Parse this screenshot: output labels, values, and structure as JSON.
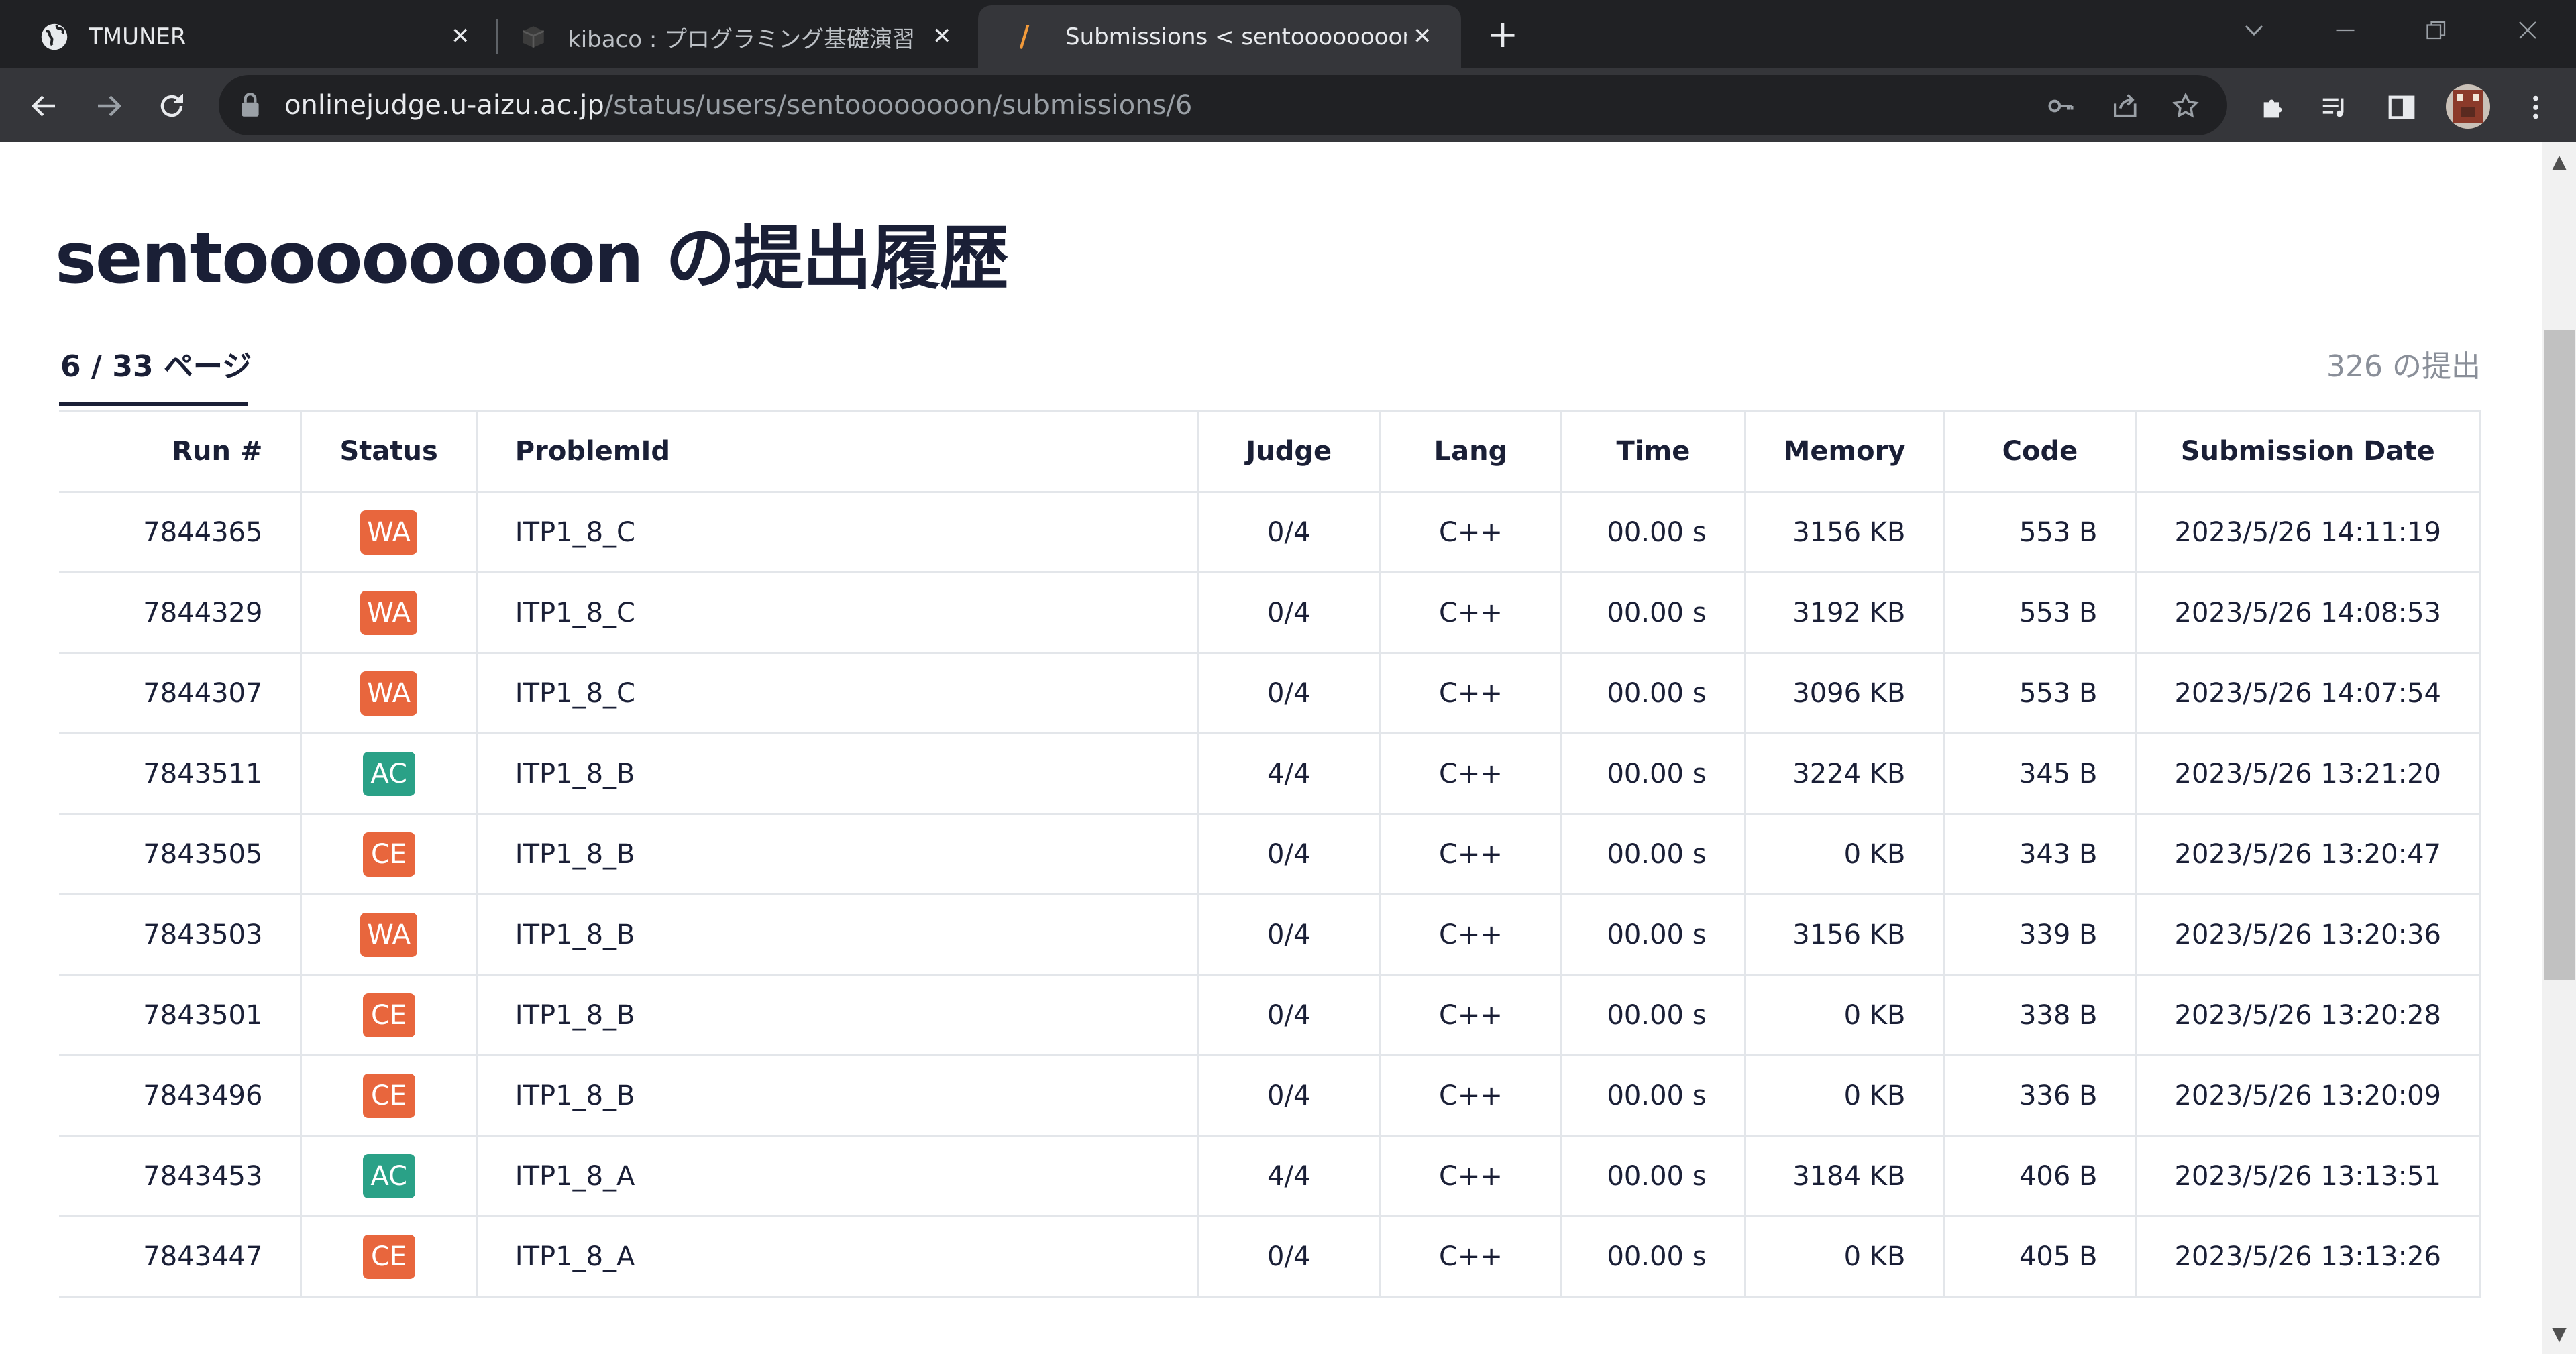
{
  "browser": {
    "tabs": [
      {
        "title": "TMUNER",
        "icon": "globe-icon",
        "active": false
      },
      {
        "title": "kibaco : プログラミング基礎演習 II",
        "icon": "kibaco-logo-icon",
        "active": false
      },
      {
        "title": "Submissions < sentoooooooon <",
        "icon": "aoj-logo-icon",
        "active": true
      }
    ],
    "url_host": "onlinejudge.u-aizu.ac.jp",
    "url_path": "/status/users/sentoooooooon/submissions/6"
  },
  "page": {
    "title": "sentoooooooon の提出履歴",
    "page_indicator": "6 / 33 ページ",
    "submission_count": "326 の提出"
  },
  "table": {
    "headers": [
      "Run #",
      "Status",
      "ProblemId",
      "Judge",
      "Lang",
      "Time",
      "Memory",
      "Code",
      "Submission Date"
    ],
    "rows": [
      {
        "run": "7844365",
        "status": "WA",
        "problem": "ITP1_8_C",
        "judge": "0/4",
        "lang": "C++",
        "time": "00.00 s",
        "memory": "3156 KB",
        "code": "553 B",
        "date": "2023/5/26 14:11:19"
      },
      {
        "run": "7844329",
        "status": "WA",
        "problem": "ITP1_8_C",
        "judge": "0/4",
        "lang": "C++",
        "time": "00.00 s",
        "memory": "3192 KB",
        "code": "553 B",
        "date": "2023/5/26 14:08:53"
      },
      {
        "run": "7844307",
        "status": "WA",
        "problem": "ITP1_8_C",
        "judge": "0/4",
        "lang": "C++",
        "time": "00.00 s",
        "memory": "3096 KB",
        "code": "553 B",
        "date": "2023/5/26 14:07:54"
      },
      {
        "run": "7843511",
        "status": "AC",
        "problem": "ITP1_8_B",
        "judge": "4/4",
        "lang": "C++",
        "time": "00.00 s",
        "memory": "3224 KB",
        "code": "345 B",
        "date": "2023/5/26 13:21:20"
      },
      {
        "run": "7843505",
        "status": "CE",
        "problem": "ITP1_8_B",
        "judge": "0/4",
        "lang": "C++",
        "time": "00.00 s",
        "memory": "0 KB",
        "code": "343 B",
        "date": "2023/5/26 13:20:47"
      },
      {
        "run": "7843503",
        "status": "WA",
        "problem": "ITP1_8_B",
        "judge": "0/4",
        "lang": "C++",
        "time": "00.00 s",
        "memory": "3156 KB",
        "code": "339 B",
        "date": "2023/5/26 13:20:36"
      },
      {
        "run": "7843501",
        "status": "CE",
        "problem": "ITP1_8_B",
        "judge": "0/4",
        "lang": "C++",
        "time": "00.00 s",
        "memory": "0 KB",
        "code": "338 B",
        "date": "2023/5/26 13:20:28"
      },
      {
        "run": "7843496",
        "status": "CE",
        "problem": "ITP1_8_B",
        "judge": "0/4",
        "lang": "C++",
        "time": "00.00 s",
        "memory": "0 KB",
        "code": "336 B",
        "date": "2023/5/26 13:20:09"
      },
      {
        "run": "7843453",
        "status": "AC",
        "problem": "ITP1_8_A",
        "judge": "4/4",
        "lang": "C++",
        "time": "00.00 s",
        "memory": "3184 KB",
        "code": "406 B",
        "date": "2023/5/26 13:13:51"
      },
      {
        "run": "7843447",
        "status": "CE",
        "problem": "ITP1_8_A",
        "judge": "0/4",
        "lang": "C++",
        "time": "00.00 s",
        "memory": "0 KB",
        "code": "405 B",
        "date": "2023/5/26 13:13:26"
      }
    ]
  },
  "colors": {
    "WA": "#e8663d",
    "CE": "#e8663d",
    "AC": "#2aa187"
  }
}
